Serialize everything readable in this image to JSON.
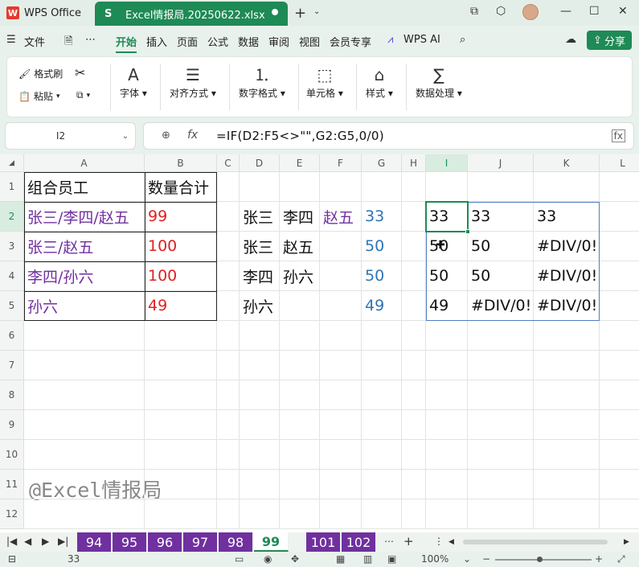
{
  "app": {
    "name": "WPS Office",
    "file_tab": "Excel情报局.20250622.xlsx"
  },
  "menu": [
    "文件",
    "开始",
    "插入",
    "页面",
    "公式",
    "数据",
    "审阅",
    "视图",
    "会员专享",
    "WPS AI"
  ],
  "share_label": "分享",
  "ribbon": {
    "format_painter": "格式刷",
    "paste": "粘贴",
    "font": "字体",
    "align": "对齐方式",
    "number_format": "数字格式",
    "cell": "单元格",
    "style": "样式",
    "data_process": "数据处理"
  },
  "name_box": "I2",
  "formula": "=IF(D2:F5<>\"\",G2:G5,0/0)",
  "columns": [
    "A",
    "B",
    "C",
    "D",
    "E",
    "F",
    "G",
    "H",
    "I",
    "J",
    "K",
    "L"
  ],
  "rows": [
    "1",
    "2",
    "3",
    "4",
    "5",
    "6",
    "7",
    "8",
    "9",
    "10",
    "11",
    "12"
  ],
  "cells": {
    "A1": "组合员工",
    "B1": "数量合计",
    "A2": "张三/李四/赵五",
    "B2": "99",
    "A3": "张三/赵五",
    "B3": "100",
    "A4": "李四/孙六",
    "B4": "100",
    "A5": "孙六",
    "B5": "49",
    "D2": "张三",
    "E2": "李四",
    "F2": "赵五",
    "G2": "33",
    "D3": "张三",
    "E3": "赵五",
    "G3": "50",
    "D4": "李四",
    "E4": "孙六",
    "G4": "50",
    "D5": "孙六",
    "G5": "49",
    "I2": "33",
    "J2": "33",
    "K2": "33",
    "I3": "50",
    "J3": "50",
    "K3": "#DIV/0!",
    "I4": "50",
    "J4": "50",
    "K4": "#DIV/0!",
    "I5": "49",
    "J5": "#DIV/0!",
    "K5": "#DIV/0!"
  },
  "watermark": "@Excel情报局",
  "sheets": [
    "94",
    "95",
    "96",
    "97",
    "98",
    "99",
    "101",
    "102"
  ],
  "active_sheet": "99",
  "status": {
    "value": "33",
    "zoom": "100%"
  },
  "colors": {
    "accent": "#1e8a55",
    "purple": "#7030a0",
    "red": "#e02020",
    "blue": "#2e75b6"
  }
}
